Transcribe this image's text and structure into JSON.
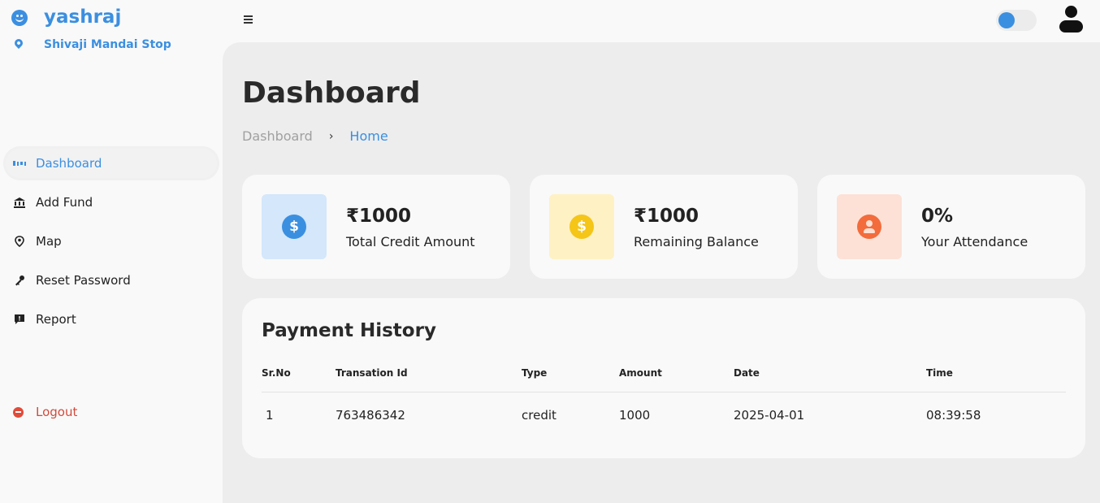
{
  "sidebar": {
    "user_name": "yashraj",
    "location": "Shivaji Mandai Stop",
    "items": [
      {
        "label": "Dashboard",
        "icon": "dashboard-icon"
      },
      {
        "label": "Add Fund",
        "icon": "bank-icon"
      },
      {
        "label": "Map",
        "icon": "location-pin-icon"
      },
      {
        "label": "Reset Password",
        "icon": "key-icon"
      },
      {
        "label": "Report",
        "icon": "report-icon"
      }
    ],
    "logout_label": "Logout"
  },
  "header": {
    "theme_toggle_on": false
  },
  "main": {
    "title": "Dashboard",
    "breadcrumb": [
      "Dashboard",
      "Home"
    ],
    "cards": [
      {
        "value": "₹1000",
        "label": "Total Credit Amount",
        "icon": "dollar-icon",
        "color": "#3b8fe0",
        "bg": "#d4e7fb"
      },
      {
        "value": "₹1000",
        "label": "Remaining Balance",
        "icon": "dollar-icon",
        "color": "#f5c518",
        "bg": "#fef1c4"
      },
      {
        "value": "0%",
        "label": "Your Attendance",
        "icon": "user-circle-icon",
        "color": "#f36c3c",
        "bg": "#fde1d6"
      }
    ],
    "payment_history": {
      "title": "Payment History",
      "columns": [
        "Sr.No",
        "Transation Id",
        "Type",
        "Amount",
        "Date",
        "Time"
      ],
      "rows": [
        [
          "1",
          "763486342",
          "credit",
          "1000",
          "2025-04-01",
          "08:39:58"
        ]
      ]
    }
  },
  "colors": {
    "accent": "#3b8fe0",
    "logout": "#d24a3a"
  }
}
